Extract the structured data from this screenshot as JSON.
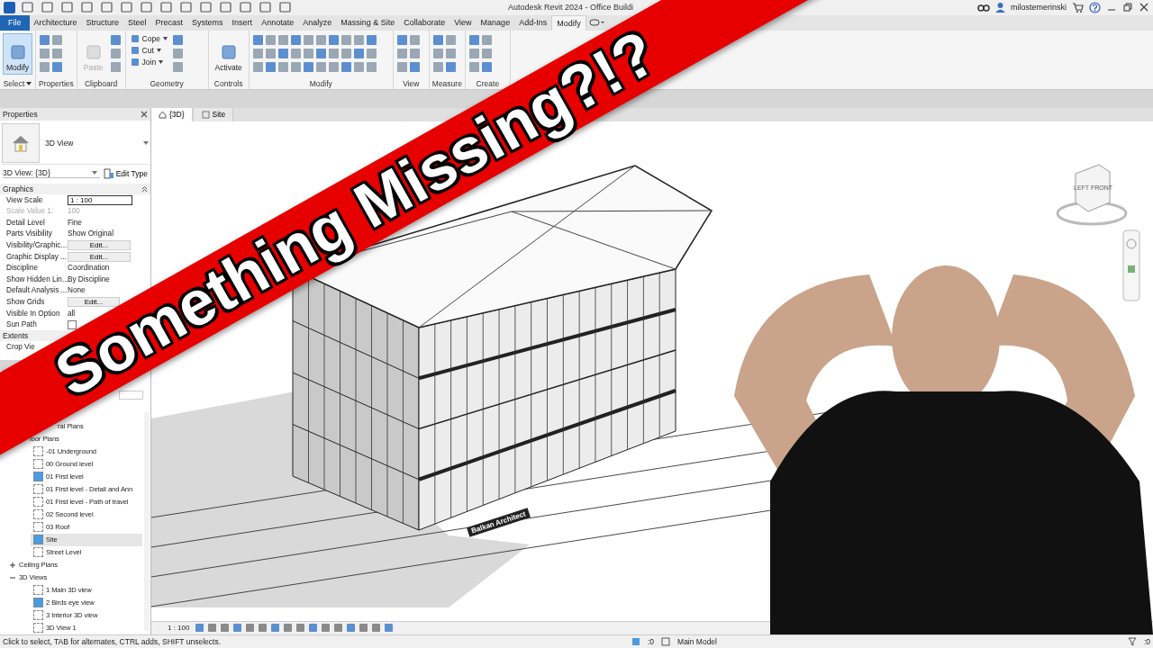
{
  "title_bar": {
    "title": "Autodesk Revit 2024 - Office Buildi",
    "user": "milostemerinski"
  },
  "ribbon": {
    "tabs": [
      {
        "label": "File",
        "kind": "file",
        "selected": false
      },
      {
        "label": "Architecture",
        "kind": "tab",
        "selected": false
      },
      {
        "label": "Structure",
        "kind": "tab",
        "selected": false
      },
      {
        "label": "Steel",
        "kind": "tab",
        "selected": false
      },
      {
        "label": "Precast",
        "kind": "tab",
        "selected": false
      },
      {
        "label": "Systems",
        "kind": "tab",
        "selected": false
      },
      {
        "label": "Insert",
        "kind": "tab",
        "selected": false
      },
      {
        "label": "Annotate",
        "kind": "tab",
        "selected": false
      },
      {
        "label": "Analyze",
        "kind": "tab",
        "selected": false
      },
      {
        "label": "Massing & Site",
        "kind": "tab",
        "selected": false
      },
      {
        "label": "Collaborate",
        "kind": "tab",
        "selected": false
      },
      {
        "label": "View",
        "kind": "tab",
        "selected": false
      },
      {
        "label": "Manage",
        "kind": "tab",
        "selected": false
      },
      {
        "label": "Add-Ins",
        "kind": "tab",
        "selected": false
      },
      {
        "label": "Modify",
        "kind": "tab",
        "selected": true
      }
    ],
    "panels": [
      {
        "label": "Select",
        "dropdown": true,
        "tools": [
          {
            "label": "Modify",
            "kind": "large",
            "selected": true,
            "disabled": false
          }
        ]
      },
      {
        "label": "Properties",
        "dropdown": false
      },
      {
        "label": "Clipboard",
        "dropdown": false,
        "tools": [
          {
            "label": "Paste",
            "kind": "large",
            "selected": false,
            "disabled": true
          }
        ]
      },
      {
        "label": "Geometry",
        "dropdown": false,
        "tools": [
          {
            "label": "Cope",
            "kind": "small",
            "selected": false,
            "disabled": false
          },
          {
            "label": "Cut",
            "kind": "small",
            "selected": false,
            "disabled": false
          },
          {
            "label": "Join",
            "kind": "small",
            "selected": false,
            "disabled": false
          }
        ]
      },
      {
        "label": "Controls",
        "dropdown": false,
        "tools": [
          {
            "label": "Activate",
            "kind": "large",
            "selected": false,
            "disabled": false
          }
        ]
      },
      {
        "label": "Modify",
        "dropdown": false
      },
      {
        "label": "View",
        "dropdown": false
      },
      {
        "label": "Measure",
        "dropdown": false
      },
      {
        "label": "Create",
        "dropdown": false
      }
    ]
  },
  "properties": {
    "title": "Properties",
    "type_name": "3D View",
    "instance": "3D View: {3D}",
    "edit_type": "Edit Type",
    "groups": [
      {
        "name": "Graphics",
        "rows": [
          {
            "name": "View Scale",
            "kind": "input",
            "value": "1 : 100",
            "disabled": false
          },
          {
            "name": "Scale Value",
            "note": "1:",
            "kind": "text",
            "value": "100",
            "disabled": true
          },
          {
            "name": "Detail Level",
            "kind": "text",
            "value": "Fine",
            "disabled": false
          },
          {
            "name": "Parts Visibility",
            "kind": "text",
            "value": "Show Original",
            "disabled": false
          },
          {
            "name": "Visibility/Graphic...",
            "kind": "button",
            "value": "Edit...",
            "disabled": false
          },
          {
            "name": "Graphic Display ...",
            "kind": "button",
            "value": "Edit...",
            "disabled": false
          },
          {
            "name": "Discipline",
            "kind": "text",
            "value": "Coordination",
            "disabled": false
          },
          {
            "name": "Show Hidden Lin...",
            "kind": "text",
            "value": "By Discipline",
            "disabled": false
          },
          {
            "name": "Default Analysis ...",
            "kind": "text",
            "value": "None",
            "disabled": false
          },
          {
            "name": "Show Grids",
            "kind": "button",
            "value": "Edit...",
            "disabled": false
          },
          {
            "name": "Visible In Option",
            "kind": "text",
            "value": "all",
            "disabled": false
          },
          {
            "name": "Sun Path",
            "kind": "checkbox",
            "checked": false,
            "disabled": false
          }
        ]
      },
      {
        "name": "Extents",
        "rows": [
          {
            "name": "Crop Vie",
            "kind": "text",
            "disabled": false
          }
        ]
      }
    ]
  },
  "browser": {
    "tree": [
      {
        "label": "ral Plans",
        "toggle": false
      },
      {
        "label": "loor Plans",
        "expanded": true,
        "toggle": false,
        "children": [
          {
            "label": "-01 Underground",
            "open": false,
            "selected": false
          },
          {
            "label": "00 Ground level",
            "open": false,
            "selected": false
          },
          {
            "label": "01 First level",
            "open": true,
            "selected": false
          },
          {
            "label": "01 First level - Detail and Ann",
            "open": false,
            "selected": false
          },
          {
            "label": "01 First level - Path of travel",
            "open": false,
            "selected": false
          },
          {
            "label": "02 Second level",
            "open": false,
            "selected": false
          },
          {
            "label": "03 Roof",
            "open": false,
            "selected": false
          },
          {
            "label": "Site",
            "open": true,
            "selected": true
          },
          {
            "label": "Street Level",
            "open": false,
            "selected": false
          }
        ]
      },
      {
        "label": "Ceiling Plans",
        "expanded": false,
        "toggle": true
      },
      {
        "label": "3D Views",
        "expanded": true,
        "toggle": true,
        "children": [
          {
            "label": "1 Main 3D view",
            "open": false,
            "selected": false
          },
          {
            "label": "2 Birds eye view",
            "open": true,
            "selected": false
          },
          {
            "label": "3 Interior 3D view",
            "open": false,
            "selected": false
          },
          {
            "label": "3D View 1",
            "open": false,
            "selected": false
          }
        ]
      }
    ]
  },
  "view": {
    "tabs": [
      {
        "label": "{3D}",
        "selected": true
      },
      {
        "label": "Site",
        "selected": false
      }
    ],
    "viewcube": {
      "left": "LEFT",
      "front": "FRONT"
    },
    "sign": "Balkan Architect",
    "scale": "1 : 100"
  },
  "status_bar": {
    "hint": "Click to select, TAB for alternates, CTRL adds, SHIFT unselects.",
    "worksets": ":0",
    "model": "Main Model",
    "filter": ":0"
  },
  "banner": {
    "text": "Something Missing?!?"
  }
}
